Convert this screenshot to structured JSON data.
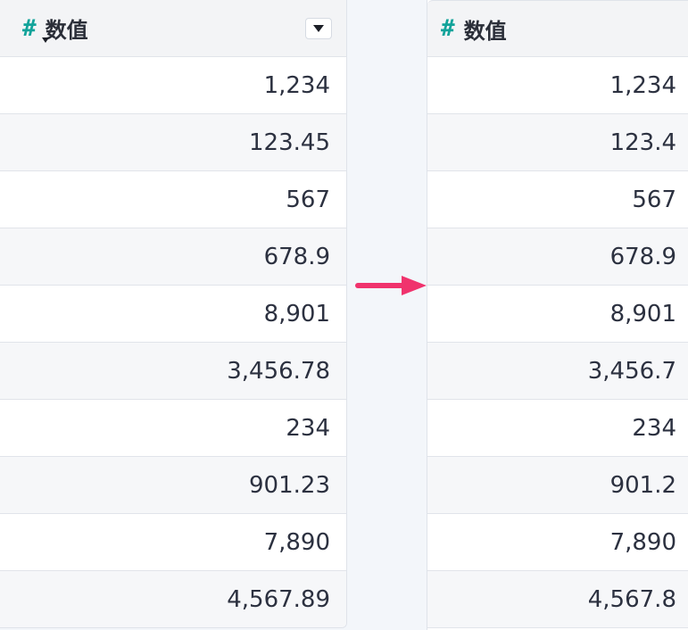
{
  "left": {
    "column_header": {
      "type_symbol": "#",
      "title": "数值",
      "menu_icon": "chevron-down-icon"
    },
    "values": [
      "1,234",
      "123.45",
      "567",
      "678.9",
      "8,901",
      "3,456.78",
      "234",
      "901.23",
      "7,890",
      "4,567.89"
    ]
  },
  "right": {
    "column_header": {
      "type_symbol": "#",
      "title": "数值"
    },
    "values": [
      "1,234",
      "123.4",
      "567",
      "678.9",
      "8,901",
      "3,456.7",
      "234",
      "901.2",
      "7,890",
      "4,567.8"
    ]
  },
  "colors": {
    "accent": "#12a39a",
    "arrow": "#f0336d",
    "header_bg": "#f3f4f6",
    "row_alt_bg": "#f6f7f9",
    "border": "#e1e4ea",
    "text": "#2c3140"
  }
}
